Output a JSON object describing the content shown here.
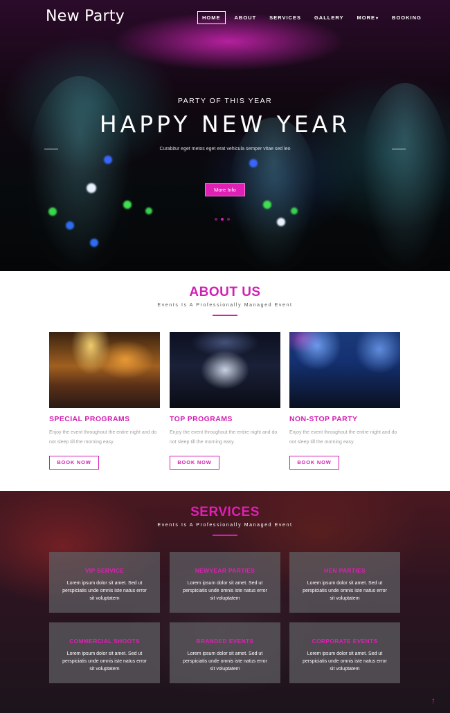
{
  "header": {
    "logo": "New Party",
    "nav": [
      {
        "label": "HOME",
        "active": true
      },
      {
        "label": "ABOUT"
      },
      {
        "label": "SERVICES"
      },
      {
        "label": "GALLERY"
      },
      {
        "label": "MORE",
        "has_dropdown": true
      },
      {
        "label": "BOOKING"
      }
    ]
  },
  "hero": {
    "kicker": "PARTY OF THIS YEAR",
    "title": "HAPPY NEW YEAR",
    "subtitle": "Curabitur eget metos eget erat vehicula semper vitae sed leo",
    "button": "More Info",
    "slides": 3,
    "active_slide": 2
  },
  "about": {
    "title": "ABOUT US",
    "subtitle": "Events Is A Professionally Managed Event",
    "cards": [
      {
        "title": "SPECIAL PROGRAMS",
        "text": "Enjoy the event throughout the entire night and do not sleep till the morning easy.",
        "button": "BOOK NOW"
      },
      {
        "title": "TOP PROGRAMS",
        "text": "Enjoy the event throughout the entire night and do not sleep till the morning easy.",
        "button": "BOOK NOW"
      },
      {
        "title": "NON-STOP PARTY",
        "text": "Enjoy the event throughout the entire night and do not sleep till the morning easy.",
        "button": "BOOK NOW"
      }
    ]
  },
  "services": {
    "title": "SERVICES",
    "subtitle": "Events Is A Professionally Managed Event",
    "items": [
      {
        "title": "VIP SERVICE",
        "text": "Lorem ipsum dolor sit amet. Sed ut perspiciatis unde omnis iste natus error sit voluptatem"
      },
      {
        "title": "NEWYEAR PARTIES",
        "text": "Lorem ipsum dolor sit amet. Sed ut perspiciatis unde omnis iste natus error sit voluptatem"
      },
      {
        "title": "HEN PARTIES",
        "text": "Lorem ipsum dolor sit amet. Sed ut perspiciatis unde omnis iste natus error sit voluptatem"
      },
      {
        "title": "COMMERCIAL SHOOTS",
        "text": "Lorem ipsum dolor sit amet. Sed ut perspiciatis unde omnis iste natus error sit voluptatem"
      },
      {
        "title": "BRANDED EVENTS",
        "text": "Lorem ipsum dolor sit amet. Sed ut perspiciatis unde omnis iste natus error sit voluptatem"
      },
      {
        "title": "CORPORATE EVENTS",
        "text": "Lorem ipsum dolor sit amet. Sed ut perspiciatis unde omnis iste natus error sit voluptatem"
      }
    ],
    "scroll_top_icon": "arrow-up-icon"
  },
  "colors": {
    "accent": "#e01fb5",
    "accent_text": "#d21fb3"
  }
}
